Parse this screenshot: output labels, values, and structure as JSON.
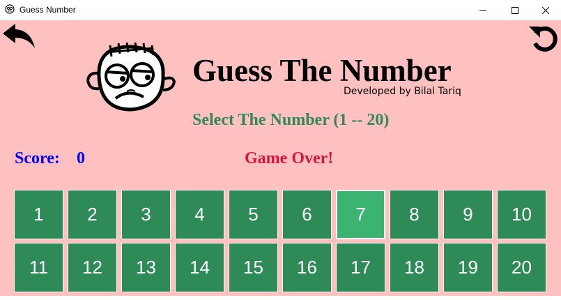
{
  "window": {
    "title": "Guess Number",
    "icon": "app-face-icon",
    "controls": [
      "minimize-icon",
      "maximize-icon",
      "close-icon"
    ]
  },
  "header": {
    "title": "Guess The Number",
    "developer": "Developed by Bilal Tariq"
  },
  "prompt": "Select The Number (1 -- 20)",
  "score": {
    "label": "Score:",
    "value": "0"
  },
  "status": "Game Over!",
  "colors": {
    "background": "#ffc0c0",
    "button": "#2e8b57",
    "button_active": "#3cb371",
    "prompt": "#2e8b57",
    "score": "#0000ff",
    "status": "#dc143c"
  },
  "selected_number": "7",
  "numbers": [
    "1",
    "2",
    "3",
    "4",
    "5",
    "6",
    "7",
    "8",
    "9",
    "10",
    "11",
    "12",
    "13",
    "14",
    "15",
    "16",
    "17",
    "18",
    "19",
    "20"
  ]
}
